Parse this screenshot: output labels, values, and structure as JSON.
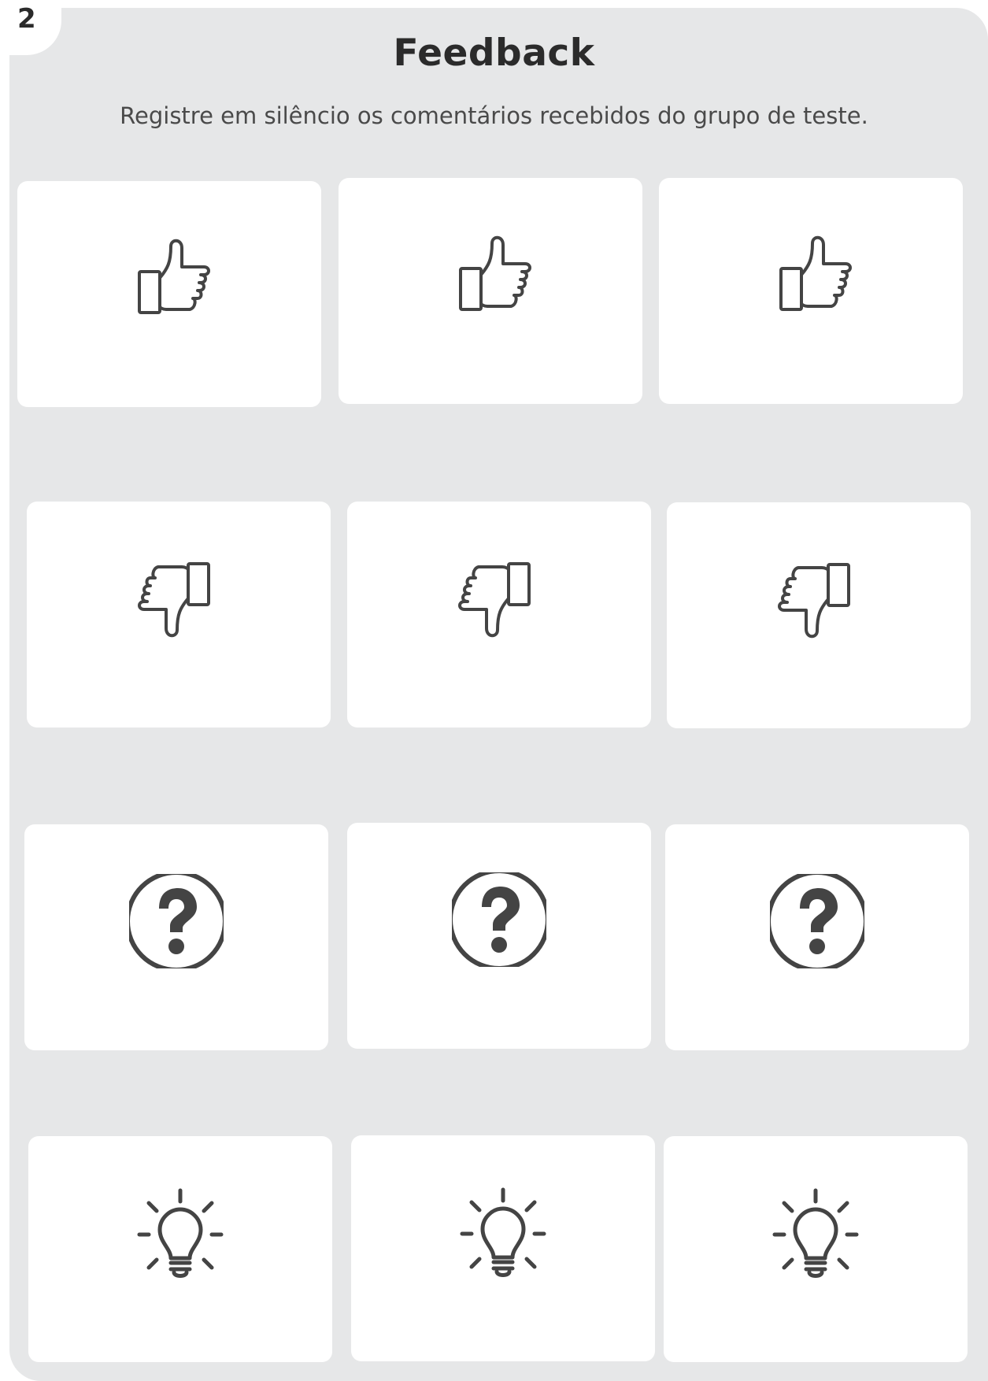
{
  "step": {
    "number": "2"
  },
  "header": {
    "title": "Feedback",
    "subtitle": "Registre em silêncio os comentários recebidos do grupo de teste."
  },
  "colors": {
    "background": "#e6e7e8",
    "card": "#ffffff",
    "icon": "#444444",
    "text": "#2b2b2b"
  },
  "rows": [
    {
      "icon": "thumbs-up-icon",
      "cards": 3
    },
    {
      "icon": "thumbs-down-icon",
      "cards": 3
    },
    {
      "icon": "question-icon",
      "cards": 3
    },
    {
      "icon": "lightbulb-icon",
      "cards": 3
    }
  ]
}
